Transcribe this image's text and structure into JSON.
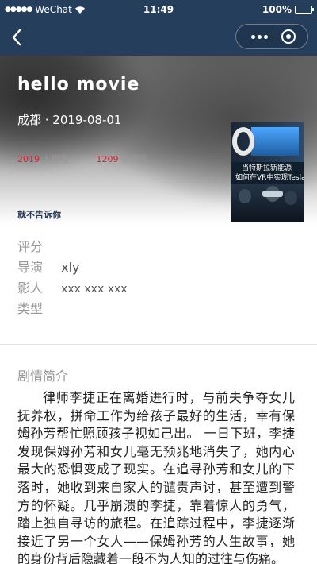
{
  "status_bar": {
    "carrier": "WeChat",
    "time": "11:49",
    "battery": "100%"
  },
  "nav": {
    "back_icon": "chevron-left-icon",
    "menu_icon": "more-dots-icon",
    "close_icon": "target-close-icon"
  },
  "movie": {
    "title": "hello movie",
    "location_date": "成都 · 2019-08-01",
    "stats": {
      "count1": "2019",
      "label1": "人想看",
      "count2": "1209",
      "label2": "条评论"
    },
    "tagline": "就不告诉你",
    "poster": {
      "text_line1": "当特斯拉新能源",
      "text_line2": "如何在VR中实现Tesla?"
    }
  },
  "info": {
    "rating_label": "评分",
    "rating_value": "",
    "director_label": "导演",
    "director_value": "xly",
    "cast_label": "影人",
    "cast_value": "xxx xxx xxx",
    "genre_label": "类型",
    "genre_value": ""
  },
  "synopsis": {
    "title": "剧情简介",
    "text": "律师李捷正在离婚进行时，与前夫争夺女儿抚养权，拼命工作为给孩子最好的生活，幸有保姆孙芳帮忙照顾孩子视如己出。 一日下班，李捷发现保姆孙芳和女儿毫无预兆地消失了，她内心最大的恐惧变成了现实。在追寻孙芳和女儿的下落时，她收到来自家人的谴责声讨，甚至遭到警方的怀疑。几乎崩溃的李捷，靠着惊人的勇气，踏上独自寻访的旅程。在追踪过程中，李捷逐渐接近了另一个女人——保姆孙芳的人生故事，她的身份背后隐藏着一段不为人知的过往与伤痛。"
  },
  "colors": {
    "nav_bg": "#253e5c",
    "accent_red": "#e0203a",
    "tag_color": "#273a55"
  }
}
